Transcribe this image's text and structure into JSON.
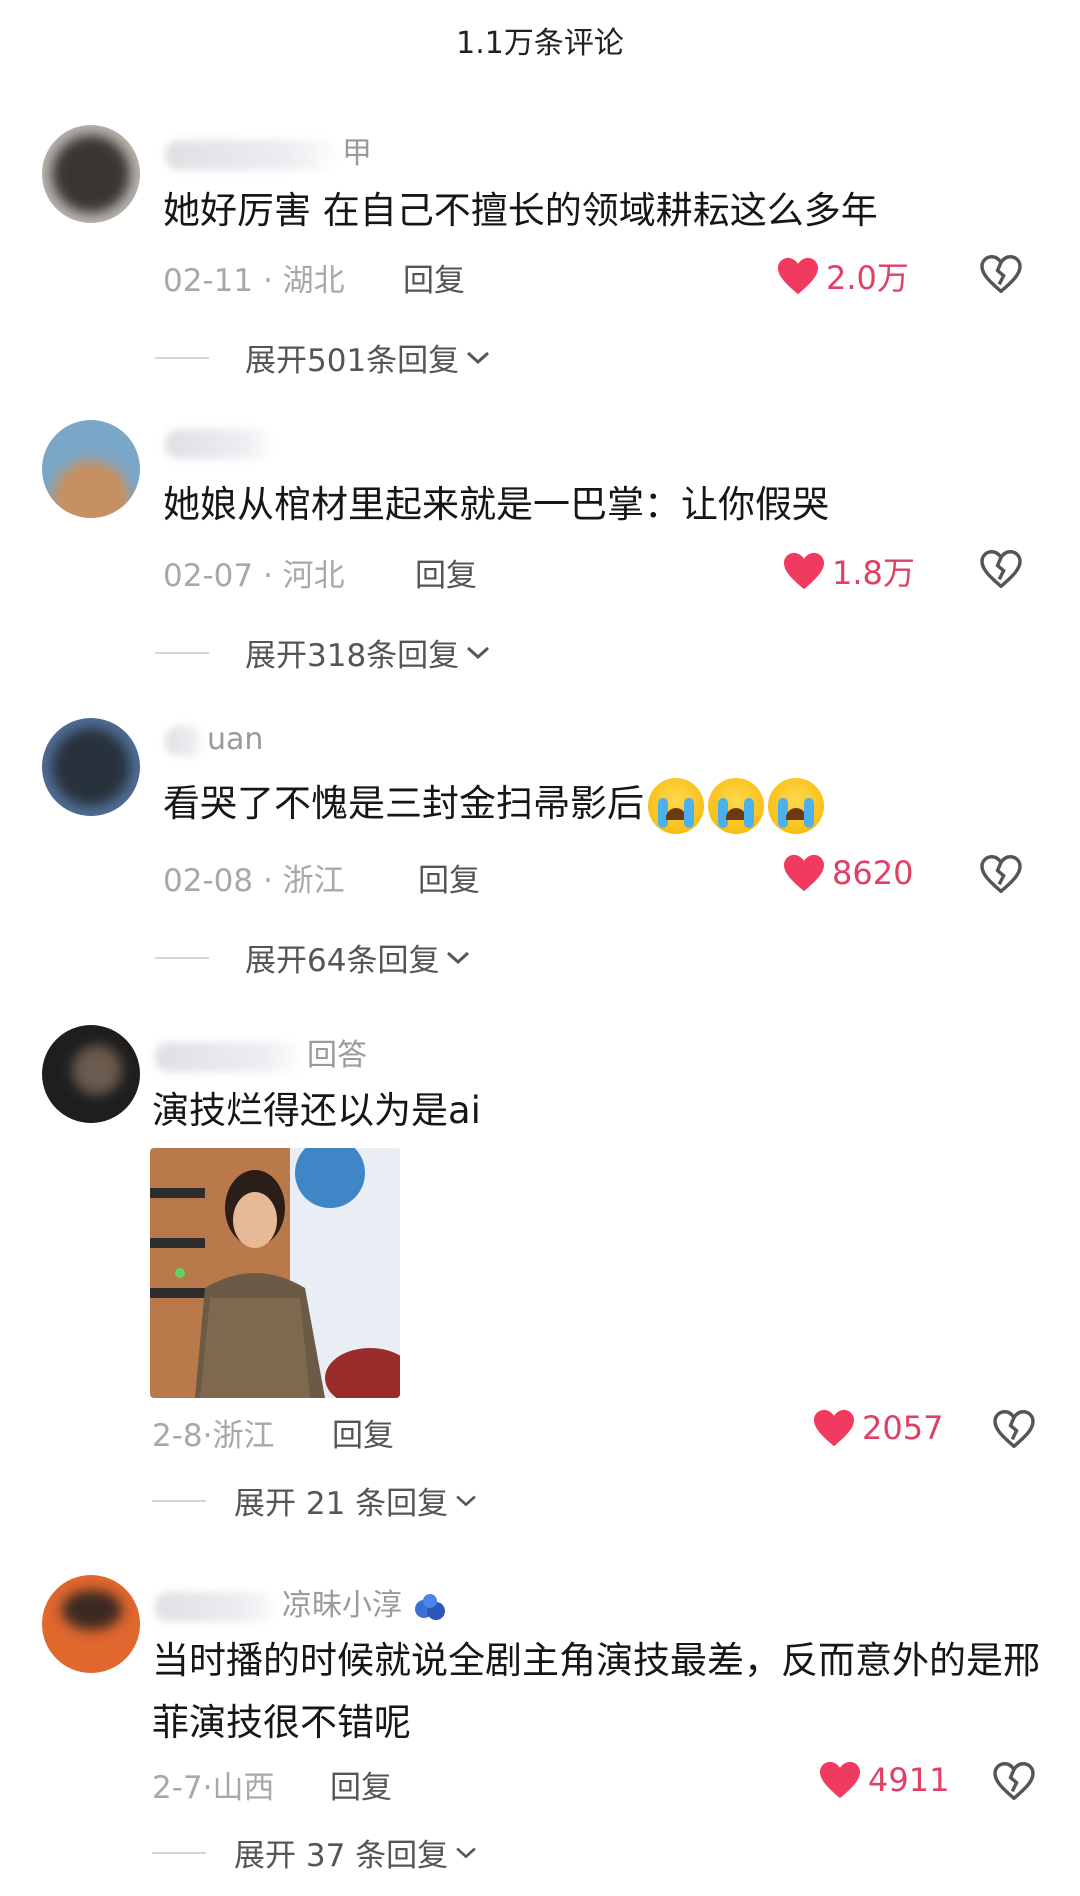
{
  "header": {
    "title": "1.1万条评论"
  },
  "comments": [
    {
      "username": "甲",
      "text": "她好厉害 在自己不擅长的领域耕耘这么多年",
      "date": "02-11",
      "location": "湖北",
      "reply_label": "回复",
      "likes": "2.0万",
      "expand": "展开501条回复"
    },
    {
      "username": "",
      "text": "她娘从棺材里起来就是一巴掌：让你假哭",
      "date": "02-07",
      "location": "河北",
      "reply_label": "回复",
      "likes": "1.8万",
      "expand": "展开318条回复"
    },
    {
      "username": "uan",
      "text": "看哭了不愧是三封金扫帚影后",
      "emoji_icon": "loudly-crying-face-icon",
      "date": "02-08",
      "location": "浙江",
      "reply_label": "回复",
      "likes": "8620",
      "expand": "展开64条回复"
    },
    {
      "username": "回答",
      "text": "演技烂得还以为是ai",
      "has_image": true,
      "date": "2-8",
      "location": "浙江",
      "reply_label": "回复",
      "likes": "2057",
      "expand": "展开 21 条回复"
    },
    {
      "username": "凉昧小淳",
      "badge_icon": "blueberry-icon",
      "text_line1": "当时播的时候就说全剧主角演技最差，反而意外的是邢",
      "text_line2": "菲演技很不错呢",
      "date": "2-7",
      "location": "山西",
      "reply_label": "回复",
      "likes": "4911",
      "expand": "展开 37 条回复"
    }
  ],
  "colors": {
    "like": "#e04064",
    "meta": "#a8a8a8",
    "text": "#161616"
  }
}
